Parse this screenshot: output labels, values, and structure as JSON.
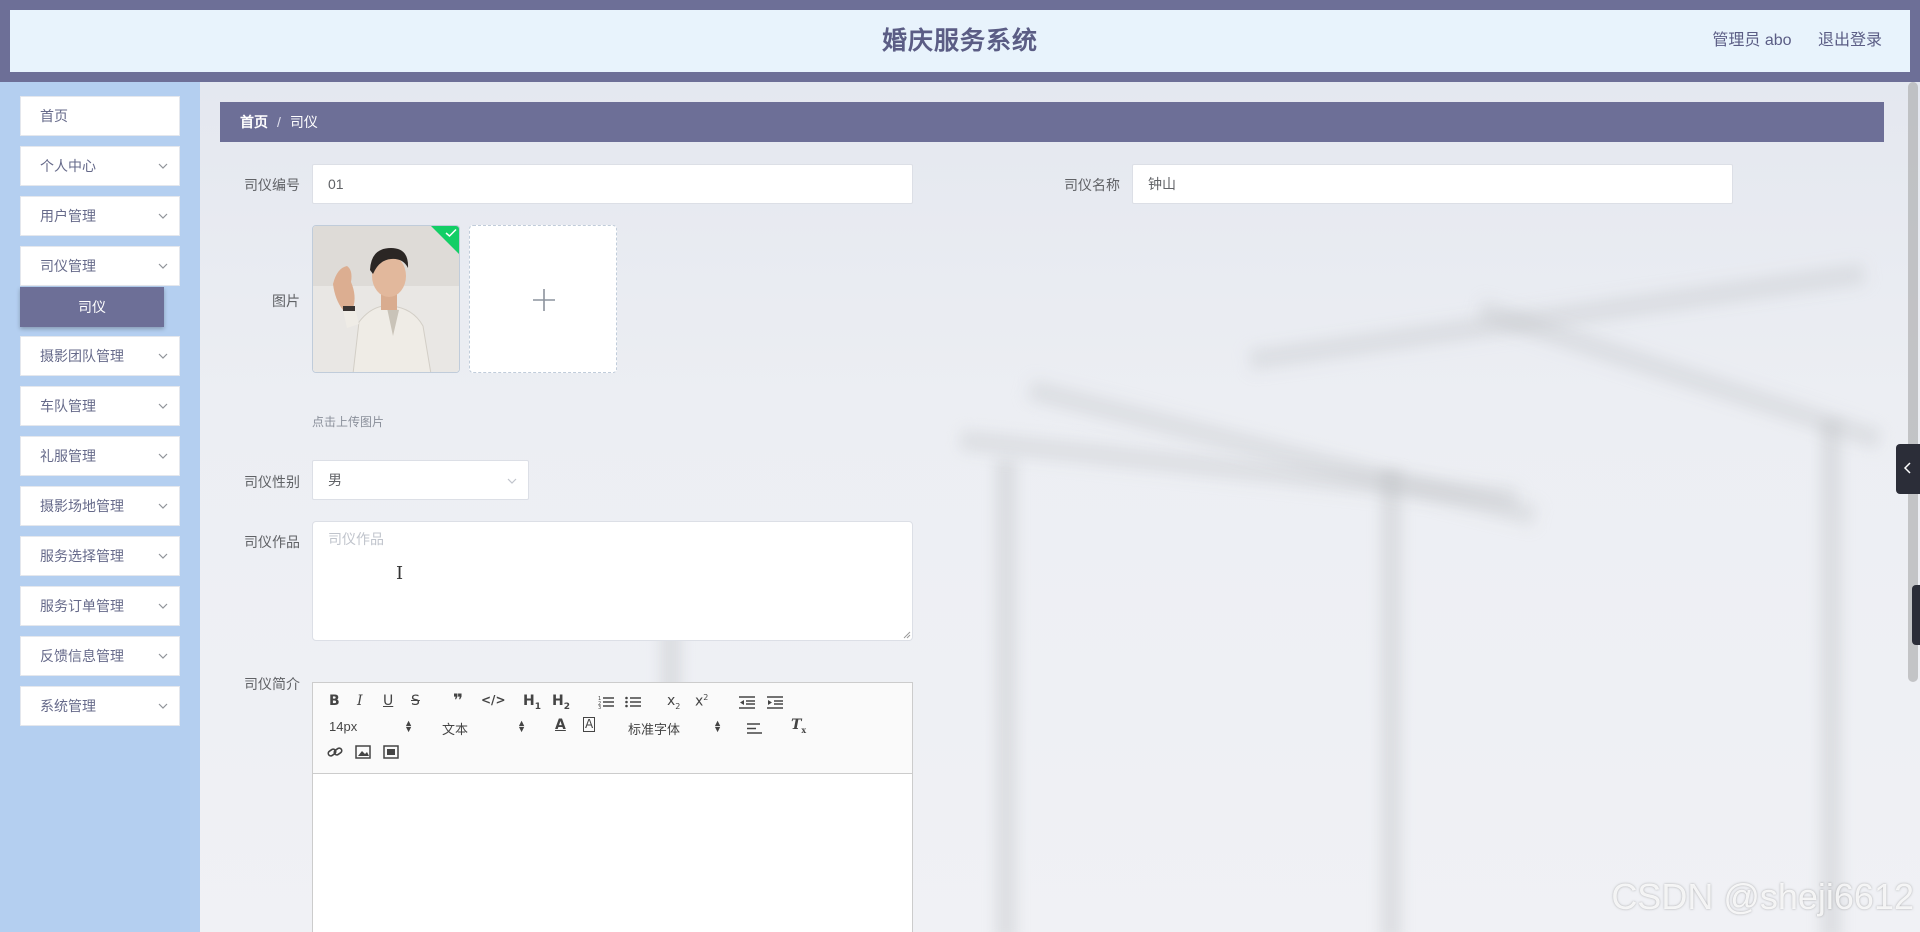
{
  "header": {
    "title": "婚庆服务系统",
    "user_label": "管理员 abo",
    "logout_label": "退出登录"
  },
  "sidebar": {
    "items": [
      {
        "label": "首页",
        "has_arrow": false
      },
      {
        "label": "个人中心",
        "has_arrow": true
      },
      {
        "label": "用户管理",
        "has_arrow": true
      },
      {
        "label": "司仪管理",
        "has_arrow": true,
        "expanded": true
      },
      {
        "label": "摄影团队管理",
        "has_arrow": true
      },
      {
        "label": "车队管理",
        "has_arrow": true
      },
      {
        "label": "礼服管理",
        "has_arrow": true
      },
      {
        "label": "摄影场地管理",
        "has_arrow": true
      },
      {
        "label": "服务选择管理",
        "has_arrow": true
      },
      {
        "label": "服务订单管理",
        "has_arrow": true
      },
      {
        "label": "反馈信息管理",
        "has_arrow": true
      },
      {
        "label": "系统管理",
        "has_arrow": true
      }
    ],
    "active_sub": "司仪"
  },
  "breadcrumb": {
    "home": "首页",
    "separator": "/",
    "current": "司仪"
  },
  "form": {
    "code_label": "司仪编号",
    "code_value": "01",
    "name_label": "司仪名称",
    "name_value": "钟山",
    "image_label": "图片",
    "upload_tip": "点击上传图片",
    "gender_label": "司仪性别",
    "gender_value": "男",
    "works_label": "司仪作品",
    "works_placeholder": "司仪作品",
    "intro_label": "司仪简介"
  },
  "editor": {
    "font_size": "14px",
    "header_select": "文本",
    "font_family": "标准字体"
  },
  "watermark": "CSDN @sheji6612",
  "colors": {
    "primary": "#6d6f97",
    "sidebar_bg": "#b4cff0",
    "header_inner": "#e8f3fc",
    "success": "#13ce66"
  }
}
